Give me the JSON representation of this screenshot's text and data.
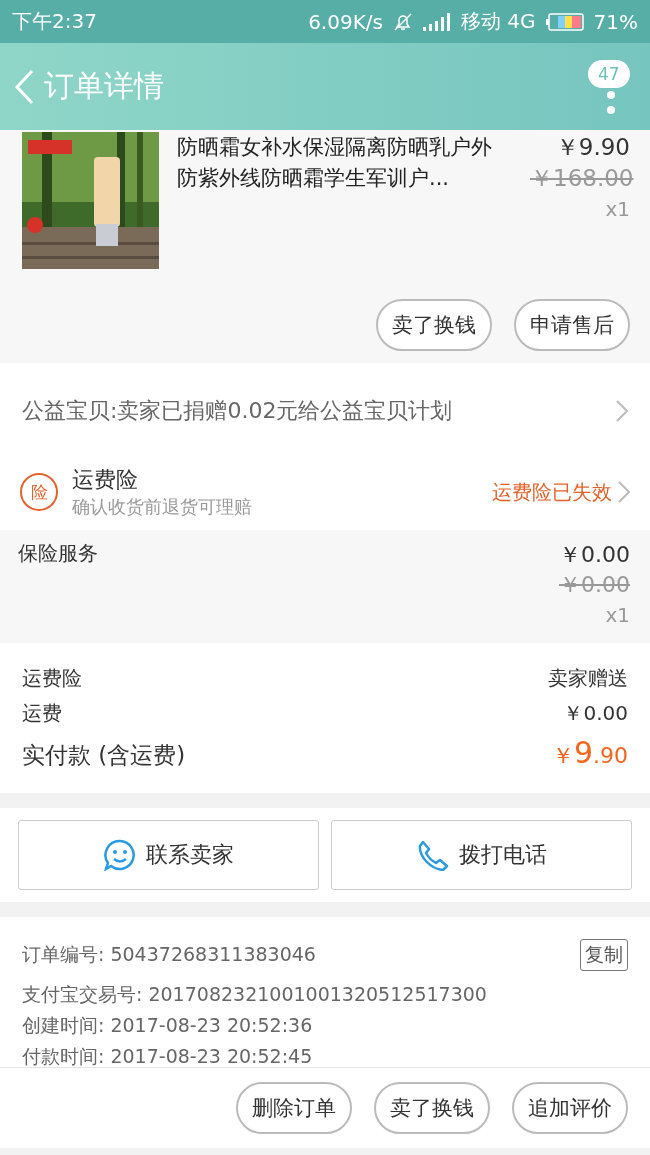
{
  "status_bar": {
    "time": "下午2:37",
    "speed": "6.09K/s",
    "carrier": "移动 4G",
    "battery": "71%"
  },
  "header": {
    "title": "订单详情",
    "badge": "47"
  },
  "product": {
    "title": "防晒霜女补水保湿隔离防晒乳户外防紫外线防晒霜学生军训户...",
    "price": "￥9.90",
    "original_price": "￥168.00",
    "quantity": "x1",
    "actions": [
      "卖了换钱",
      "申请售后"
    ]
  },
  "charity": {
    "text": "公益宝贝:卖家已捐赠0.02元给公益宝贝计划"
  },
  "shipping_insurance": {
    "icon_char": "险",
    "title": "运费险",
    "subtitle": "确认收货前退货可理赔",
    "status": "运费险已失效"
  },
  "insurance_service": {
    "name": "保险服务",
    "price": "￥0.00",
    "original_price": "￥0.00",
    "quantity": "x1"
  },
  "summary": {
    "rows": [
      {
        "label": "运费险",
        "value": "卖家赠送"
      },
      {
        "label": "运费",
        "value": "￥0.00"
      }
    ],
    "total_label": "实付款 (含运费)",
    "total_symbol": "￥",
    "total_int": "9",
    "total_dec": ".90"
  },
  "contact": [
    {
      "kind": "chat",
      "label": "联系卖家"
    },
    {
      "kind": "phone",
      "label": "拨打电话"
    }
  ],
  "order_info": {
    "number": "订单编号: 50437268311383046",
    "copy": "复制",
    "lines": [
      "支付宝交易号: 2017082321001001320512517300",
      "创建时间: 2017-08-23 20:52:36",
      "付款时间: 2017-08-23 20:52:45"
    ]
  },
  "bottom_actions": [
    "删除订单",
    "卖了换钱",
    "追加评价"
  ]
}
